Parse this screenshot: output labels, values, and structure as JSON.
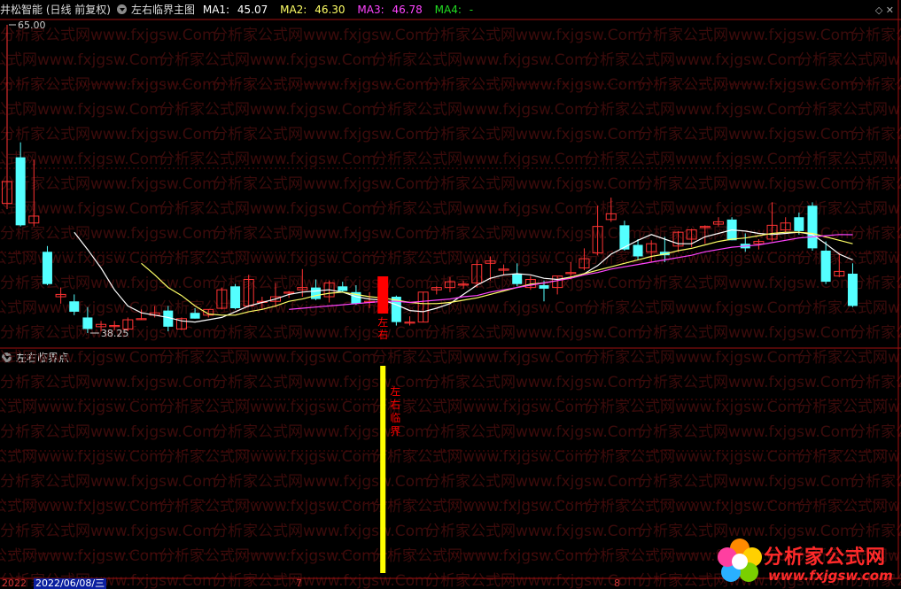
{
  "main": {
    "stock_label": "井松智能 (日线 前复权)",
    "indicator_name": "左右临界主图",
    "ma": [
      {
        "label": "MA1:",
        "value": "45.07",
        "color": "#ffffff"
      },
      {
        "label": "MA2:",
        "value": "46.30",
        "color": "#ffff66"
      },
      {
        "label": "MA3:",
        "value": "46.78",
        "color": "#ff44ff"
      },
      {
        "label": "MA4:",
        "value": "-",
        "color": "#22dd22"
      }
    ],
    "high_label": "65.00",
    "low_label": "38.25",
    "signal_text": "左右"
  },
  "sub": {
    "indicator_name": "左右临界点",
    "signal_text": "左右临界"
  },
  "date_bar": {
    "year": "2022",
    "date": "2022/06/08/三",
    "month7": "7",
    "month8": "8"
  },
  "logo": {
    "title": "分析家公式网",
    "url": "www.fxjgsw.com"
  },
  "watermark_text": "分析家公式网www.fxjgsw.Com",
  "colors": {
    "up": "#ff3333",
    "down": "#54ffff",
    "signal": "#ff0000",
    "bar": "#ffff00",
    "border": "#a01010"
  },
  "chart_data": {
    "type": "candlestick",
    "ylim": [
      38.25,
      65.0
    ],
    "candles": [
      {
        "o": 49.5,
        "h": 65.0,
        "l": 49.0,
        "c": 51.4
      },
      {
        "o": 53.5,
        "h": 54.8,
        "l": 47.5,
        "c": 47.6
      },
      {
        "o": 47.8,
        "h": 53.3,
        "l": 47.5,
        "c": 48.4
      },
      {
        "o": 45.3,
        "h": 45.8,
        "l": 42.4,
        "c": 42.5
      },
      {
        "o": 41.4,
        "h": 42.2,
        "l": 40.8,
        "c": 41.6
      },
      {
        "o": 41.0,
        "h": 41.6,
        "l": 39.8,
        "c": 40.1
      },
      {
        "o": 39.6,
        "h": 40.5,
        "l": 38.25,
        "c": 38.6
      },
      {
        "o": 38.8,
        "h": 39.3,
        "l": 38.4,
        "c": 39.0
      },
      {
        "o": 38.9,
        "h": 39.3,
        "l": 38.5,
        "c": 38.9
      },
      {
        "o": 38.6,
        "h": 39.6,
        "l": 38.4,
        "c": 39.4
      },
      {
        "o": 39.5,
        "h": 40.3,
        "l": 39.4,
        "c": 39.5
      },
      {
        "o": 39.8,
        "h": 40.6,
        "l": 39.6,
        "c": 40.0
      },
      {
        "o": 40.2,
        "h": 40.6,
        "l": 38.4,
        "c": 38.8
      },
      {
        "o": 38.6,
        "h": 39.6,
        "l": 38.5,
        "c": 39.5
      },
      {
        "o": 40.0,
        "h": 40.4,
        "l": 39.5,
        "c": 39.5
      },
      {
        "o": 39.8,
        "h": 40.3,
        "l": 39.6,
        "c": 40.3
      },
      {
        "o": 40.4,
        "h": 42.2,
        "l": 40.3,
        "c": 42.0
      },
      {
        "o": 42.3,
        "h": 42.5,
        "l": 40.3,
        "c": 40.4
      },
      {
        "o": 40.6,
        "h": 43.3,
        "l": 40.5,
        "c": 42.9
      },
      {
        "o": 41.0,
        "h": 41.4,
        "l": 40.3,
        "c": 41.0
      },
      {
        "o": 41.0,
        "h": 42.6,
        "l": 40.5,
        "c": 41.4
      },
      {
        "o": 41.8,
        "h": 41.9,
        "l": 41.3,
        "c": 41.8
      },
      {
        "o": 42.0,
        "h": 43.8,
        "l": 41.4,
        "c": 42.2
      },
      {
        "o": 42.2,
        "h": 42.9,
        "l": 41.1,
        "c": 41.2
      },
      {
        "o": 41.4,
        "h": 42.8,
        "l": 40.9,
        "c": 42.6
      },
      {
        "o": 42.3,
        "h": 42.7,
        "l": 41.8,
        "c": 41.9
      },
      {
        "o": 41.8,
        "h": 42.4,
        "l": 40.7,
        "c": 40.8
      },
      {
        "o": 41.0,
        "h": 41.8,
        "l": 40.4,
        "c": 41.0
      },
      {
        "o": 41.4,
        "h": 41.6,
        "l": 40.8,
        "c": 41.1
      },
      {
        "o": 41.4,
        "h": 41.5,
        "l": 38.9,
        "c": 39.2
      },
      {
        "o": 39.2,
        "h": 39.7,
        "l": 38.9,
        "c": 39.2
      },
      {
        "o": 39.2,
        "h": 41.8,
        "l": 39.2,
        "c": 41.8
      },
      {
        "o": 42.0,
        "h": 42.3,
        "l": 41.6,
        "c": 42.2
      },
      {
        "o": 42.2,
        "h": 43.1,
        "l": 41.8,
        "c": 42.7
      },
      {
        "o": 42.5,
        "h": 42.8,
        "l": 42.1,
        "c": 42.5
      },
      {
        "o": 42.6,
        "h": 44.6,
        "l": 42.2,
        "c": 44.2
      },
      {
        "o": 44.3,
        "h": 44.9,
        "l": 42.8,
        "c": 44.5
      },
      {
        "o": 43.7,
        "h": 44.2,
        "l": 43.3,
        "c": 43.8
      },
      {
        "o": 43.4,
        "h": 44.3,
        "l": 42.3,
        "c": 42.5
      },
      {
        "o": 42.2,
        "h": 43.2,
        "l": 42.0,
        "c": 42.9
      },
      {
        "o": 42.4,
        "h": 42.8,
        "l": 41.0,
        "c": 42.1
      },
      {
        "o": 42.2,
        "h": 43.2,
        "l": 41.6,
        "c": 43.2
      },
      {
        "o": 43.5,
        "h": 44.4,
        "l": 42.9,
        "c": 43.5
      },
      {
        "o": 43.9,
        "h": 45.6,
        "l": 43.7,
        "c": 44.7
      },
      {
        "o": 45.2,
        "h": 49.3,
        "l": 45.0,
        "c": 47.5
      },
      {
        "o": 48.1,
        "h": 50.0,
        "l": 47.9,
        "c": 48.6
      },
      {
        "o": 47.6,
        "h": 48.0,
        "l": 45.4,
        "c": 45.5
      },
      {
        "o": 45.9,
        "h": 46.4,
        "l": 44.6,
        "c": 44.9
      },
      {
        "o": 45.3,
        "h": 46.3,
        "l": 44.4,
        "c": 46.0
      },
      {
        "o": 45.3,
        "h": 46.6,
        "l": 44.4,
        "c": 45.0
      },
      {
        "o": 45.8,
        "h": 47.1,
        "l": 45.3,
        "c": 47.0
      },
      {
        "o": 46.4,
        "h": 47.3,
        "l": 45.7,
        "c": 47.2
      },
      {
        "o": 47.5,
        "h": 47.6,
        "l": 46.0,
        "c": 47.5
      },
      {
        "o": 47.7,
        "h": 48.3,
        "l": 47.5,
        "c": 47.9
      },
      {
        "o": 48.1,
        "h": 48.3,
        "l": 46.3,
        "c": 46.3
      },
      {
        "o": 46.0,
        "h": 46.9,
        "l": 45.3,
        "c": 45.6
      },
      {
        "o": 46.0,
        "h": 46.4,
        "l": 45.5,
        "c": 46.2
      },
      {
        "o": 46.4,
        "h": 49.6,
        "l": 46.2,
        "c": 47.6
      },
      {
        "o": 47.2,
        "h": 48.3,
        "l": 47.0,
        "c": 47.8
      },
      {
        "o": 48.3,
        "h": 48.7,
        "l": 46.8,
        "c": 47.1
      },
      {
        "o": 49.3,
        "h": 49.6,
        "l": 45.4,
        "c": 45.6
      },
      {
        "o": 45.4,
        "h": 46.2,
        "l": 42.5,
        "c": 42.7
      },
      {
        "o": 43.2,
        "h": 45.2,
        "l": 43.1,
        "c": 43.6
      },
      {
        "o": 43.4,
        "h": 44.3,
        "l": 40.5,
        "c": 40.6
      }
    ],
    "ma1": [
      null,
      null,
      null,
      null,
      null,
      47.0,
      45.5,
      43.9,
      42.0,
      40.6,
      40.0,
      39.8,
      39.6,
      39.3,
      39.2,
      39.4,
      39.6,
      40.1,
      40.6,
      40.9,
      41.2,
      41.6,
      41.8,
      41.9,
      42.0,
      41.8,
      41.4,
      41.2,
      41.1,
      40.7,
      40.2,
      40.1,
      40.4,
      40.8,
      41.6,
      42.4,
      43.0,
      43.3,
      43.4,
      43.3,
      43.0,
      42.9,
      43.1,
      43.4,
      44.1,
      45.1,
      45.7,
      46.3,
      46.8,
      46.4,
      46.0,
      46.0,
      46.6,
      46.9,
      47.2,
      47.1,
      46.9,
      46.8,
      46.9,
      47.0,
      46.8,
      46.0,
      45.1,
      44.6
    ],
    "ma2": [
      null,
      null,
      null,
      null,
      null,
      null,
      null,
      null,
      null,
      null,
      44.3,
      43.3,
      42.2,
      41.5,
      40.6,
      39.9,
      39.8,
      39.8,
      40.1,
      40.3,
      40.6,
      41.0,
      41.2,
      41.5,
      41.7,
      41.8,
      41.6,
      41.4,
      41.3,
      41.1,
      40.9,
      40.8,
      40.8,
      40.9,
      41.1,
      41.3,
      41.6,
      41.9,
      42.2,
      42.5,
      42.6,
      42.8,
      43.1,
      43.4,
      43.7,
      44.0,
      44.3,
      44.6,
      44.9,
      45.1,
      45.4,
      45.6,
      45.9,
      46.2,
      46.4,
      46.5,
      46.7,
      46.9,
      47.0,
      47.0,
      46.9,
      46.6,
      46.3,
      46.0
    ],
    "ma3": [
      null,
      null,
      null,
      null,
      null,
      null,
      null,
      null,
      null,
      null,
      null,
      null,
      null,
      null,
      null,
      null,
      null,
      null,
      null,
      null,
      null,
      40.3,
      40.4,
      40.5,
      40.6,
      40.7,
      40.8,
      40.9,
      41.0,
      41.0,
      40.9,
      41.0,
      41.1,
      41.2,
      41.4,
      41.5,
      41.8,
      42.0,
      42.2,
      42.4,
      42.6,
      42.8,
      43.0,
      43.3,
      43.5,
      43.8,
      44.0,
      44.2,
      44.4,
      44.6,
      44.8,
      45.0,
      45.3,
      45.5,
      45.7,
      45.8,
      45.9,
      46.1,
      46.3,
      46.5,
      46.6,
      46.7,
      46.8,
      46.78
    ],
    "signal_index": 28
  }
}
